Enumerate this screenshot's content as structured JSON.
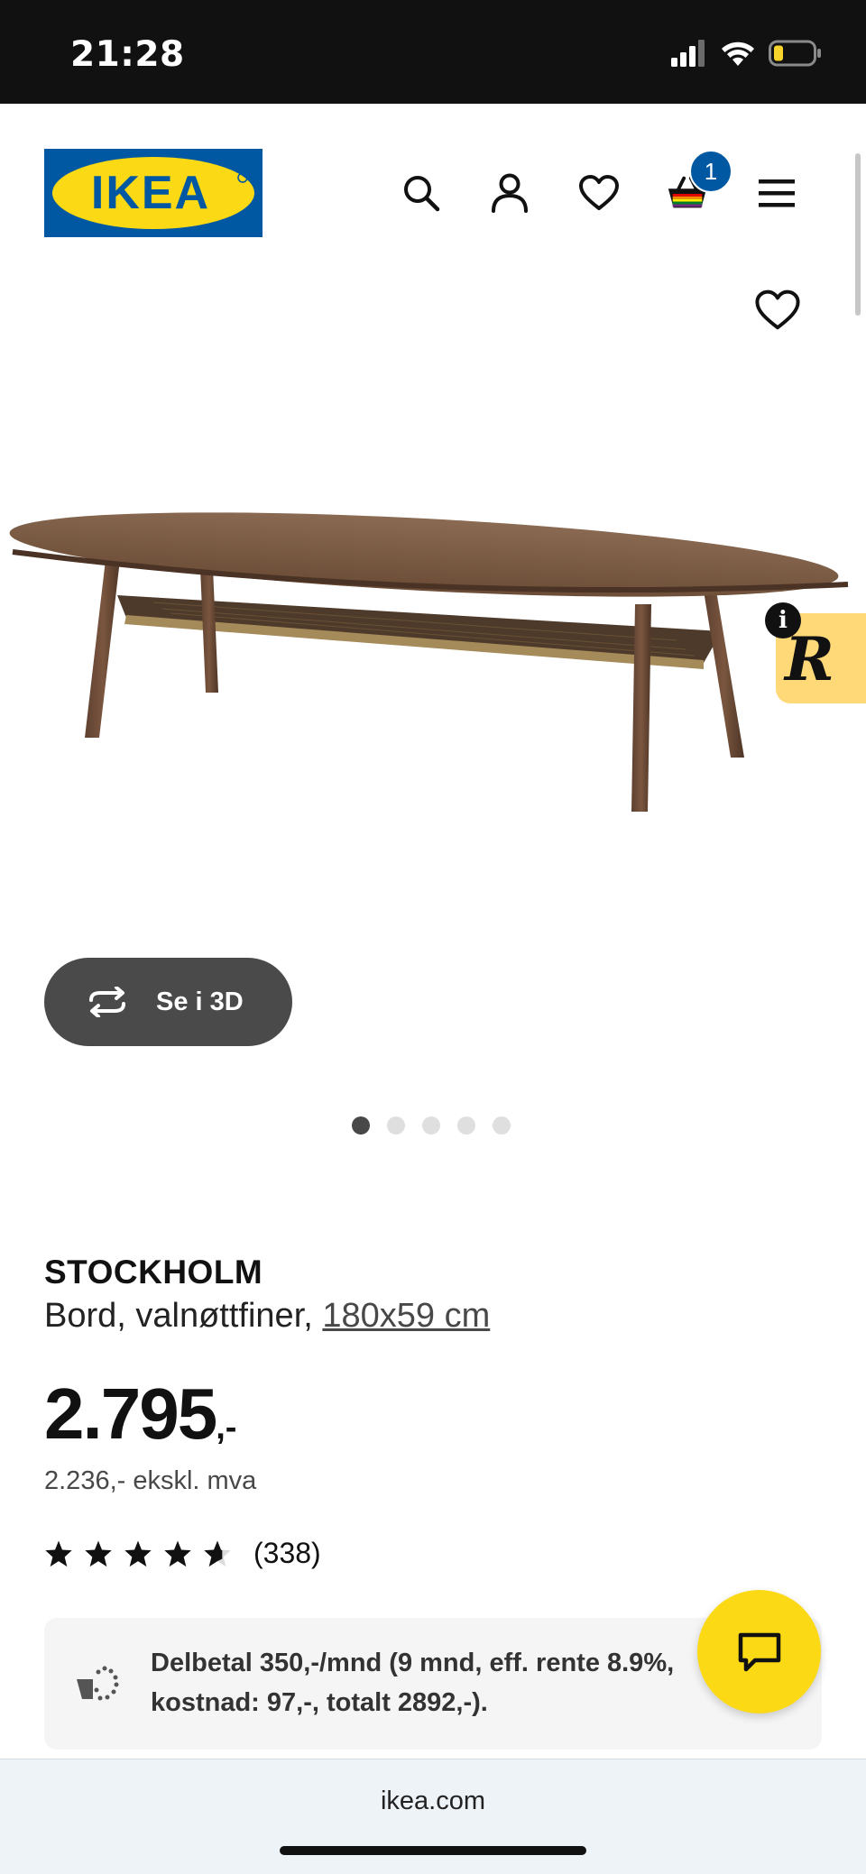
{
  "status_bar": {
    "time": "21:28"
  },
  "header": {
    "logo_text": "IKEA",
    "cart_count": "1",
    "icons": [
      "search-icon",
      "user-icon",
      "heart-icon",
      "cart-icon",
      "menu-icon"
    ]
  },
  "gallery": {
    "view_3d_label": "Se i 3D",
    "slide_count": 5,
    "active_slide": 1,
    "widget_info": "i",
    "widget_letter": "R"
  },
  "product": {
    "name": "STOCKHOLM",
    "description": "Bord, valnøttfiner,",
    "size_link": "180x59 cm",
    "price_main": "2.795",
    "price_suffix": ",-",
    "price_excl_vat": "2.236,- ekskl. mva",
    "rating_value": 4.5,
    "rating_count": "(338)"
  },
  "installment": {
    "text": "Delbetal 350,-/mnd (9 mnd, eff. rente 8.9%, kostnad: 97,-, totalt 2892,-)."
  },
  "browser": {
    "url": "ikea.com"
  },
  "colors": {
    "ikea_blue": "#0058a3",
    "ikea_yellow": "#fbd914",
    "chat_yellow": "#fbd914",
    "dark_button": "#4a4a4a"
  }
}
